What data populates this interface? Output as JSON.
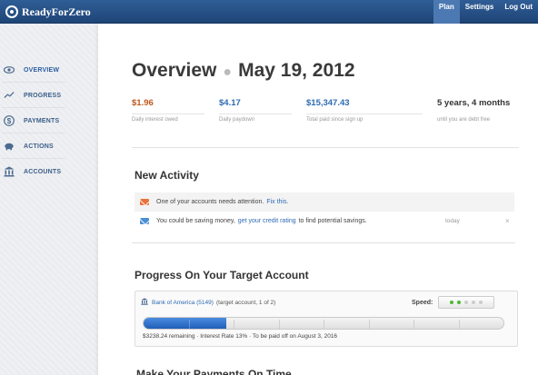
{
  "app": {
    "name": "ReadyForZero"
  },
  "topnav": [
    {
      "label": "Plan",
      "active": true
    },
    {
      "label": "Settings",
      "active": false
    },
    {
      "label": "Log Out",
      "active": false
    }
  ],
  "sidebar": {
    "items": [
      {
        "label": "OVERVIEW",
        "icon": "eye-icon",
        "active": true
      },
      {
        "label": "PROGRESS",
        "icon": "line-graph-icon",
        "active": false
      },
      {
        "label": "PAYMENTS",
        "icon": "dollar-icon",
        "active": false
      },
      {
        "label": "ACTIONS",
        "icon": "piggy-bank-icon",
        "active": false
      },
      {
        "label": "ACCOUNTS",
        "icon": "bank-icon",
        "active": false
      }
    ]
  },
  "overview": {
    "title": "Overview",
    "date": "May 19, 2012"
  },
  "stats": [
    {
      "value": "$1.96",
      "label": "Daily interest owed",
      "color": "#c0561c"
    },
    {
      "value": "$4.17",
      "label": "Daily paydown",
      "color": "#2d6bb3"
    },
    {
      "value": "$15,347.43",
      "label": "Total paid since sign up",
      "color": "#2d6bb3"
    },
    {
      "value": "5 years, 4 months",
      "label": "until you are debt free",
      "color": "#333333"
    }
  ],
  "activity": {
    "title": "New Activity",
    "items": [
      {
        "text": "One of your accounts needs attention.",
        "link": "Fix this.",
        "after": "",
        "time": "",
        "icon": "mail-alert-icon",
        "icon_color": "#e8743b"
      },
      {
        "text": "You could be saving money,",
        "link": "get your credit rating",
        "after": "to find potential savings.",
        "time": "today",
        "icon": "mail-info-icon",
        "icon_color": "#4a8fd4"
      }
    ]
  },
  "progress": {
    "title": "Progress On Your Target Account",
    "account_name": "Bank of America (5149)",
    "account_note": "(target account, 1 of 2)",
    "speed_label": "Speed:",
    "speed_level": 2,
    "speed_max": 5,
    "fill_fraction": 0.23,
    "summary": "$3238.24 remaining  ·  Interest Rate 13%  ·  To be paid off on August 3, 2016"
  },
  "next_section": {
    "title": "Make Your Payments On Time"
  }
}
